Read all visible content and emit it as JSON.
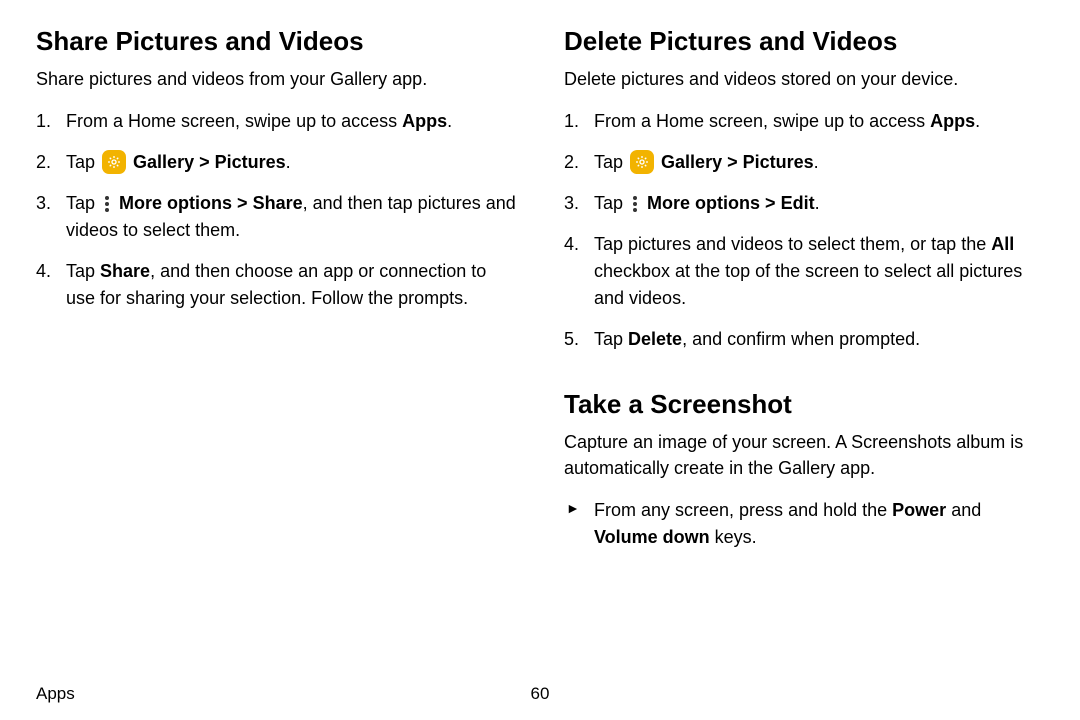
{
  "left": {
    "heading": "Share Pictures and Videos",
    "intro": "Share pictures and videos from your Gallery app.",
    "step1_pre": "From a Home screen, swipe up to access ",
    "step1_bold": "Apps",
    "step1_post": ".",
    "step2_pre": "Tap ",
    "step2_gallery": "Gallery",
    "step2_sep": " > ",
    "step2_pictures": "Pictures",
    "step2_post": ".",
    "step3_pre": "Tap ",
    "step3_more": "More options",
    "step3_sep": " > ",
    "step3_share": "Share",
    "step3_post": ", and then tap pictures and videos to select them.",
    "step4_pre": "Tap ",
    "step4_share": "Share",
    "step4_post": ", and then choose an app or connection to use for sharing your selection. Follow the prompts."
  },
  "right_a": {
    "heading": "Delete Pictures and Videos",
    "intro": "Delete pictures and videos stored on your device.",
    "step1_pre": "From a Home screen, swipe up to access ",
    "step1_bold": "Apps",
    "step1_post": ".",
    "step2_pre": "Tap ",
    "step2_gallery": "Gallery",
    "step2_sep": " > ",
    "step2_pictures": "Pictures",
    "step2_post": ".",
    "step3_pre": "Tap ",
    "step3_more": "More options",
    "step3_sep": " > ",
    "step3_edit": "Edit",
    "step3_post": ".",
    "step4_pre": "Tap pictures and videos to select them, or tap the ",
    "step4_all": "All",
    "step4_post": " checkbox at the top of the screen to select all pictures and videos.",
    "step5_pre": "Tap ",
    "step5_delete": "Delete",
    "step5_post": ", and confirm when prompted."
  },
  "right_b": {
    "heading": "Take a Screenshot",
    "intro": "Capture an image of your screen. A Screenshots album is automatically create in the Gallery app.",
    "bullet_pre": "From any screen, press and hold the ",
    "bullet_power": "Power",
    "bullet_mid": " and ",
    "bullet_vol": "Volume down",
    "bullet_post": " keys."
  },
  "footer": {
    "section": "Apps",
    "page": "60"
  }
}
